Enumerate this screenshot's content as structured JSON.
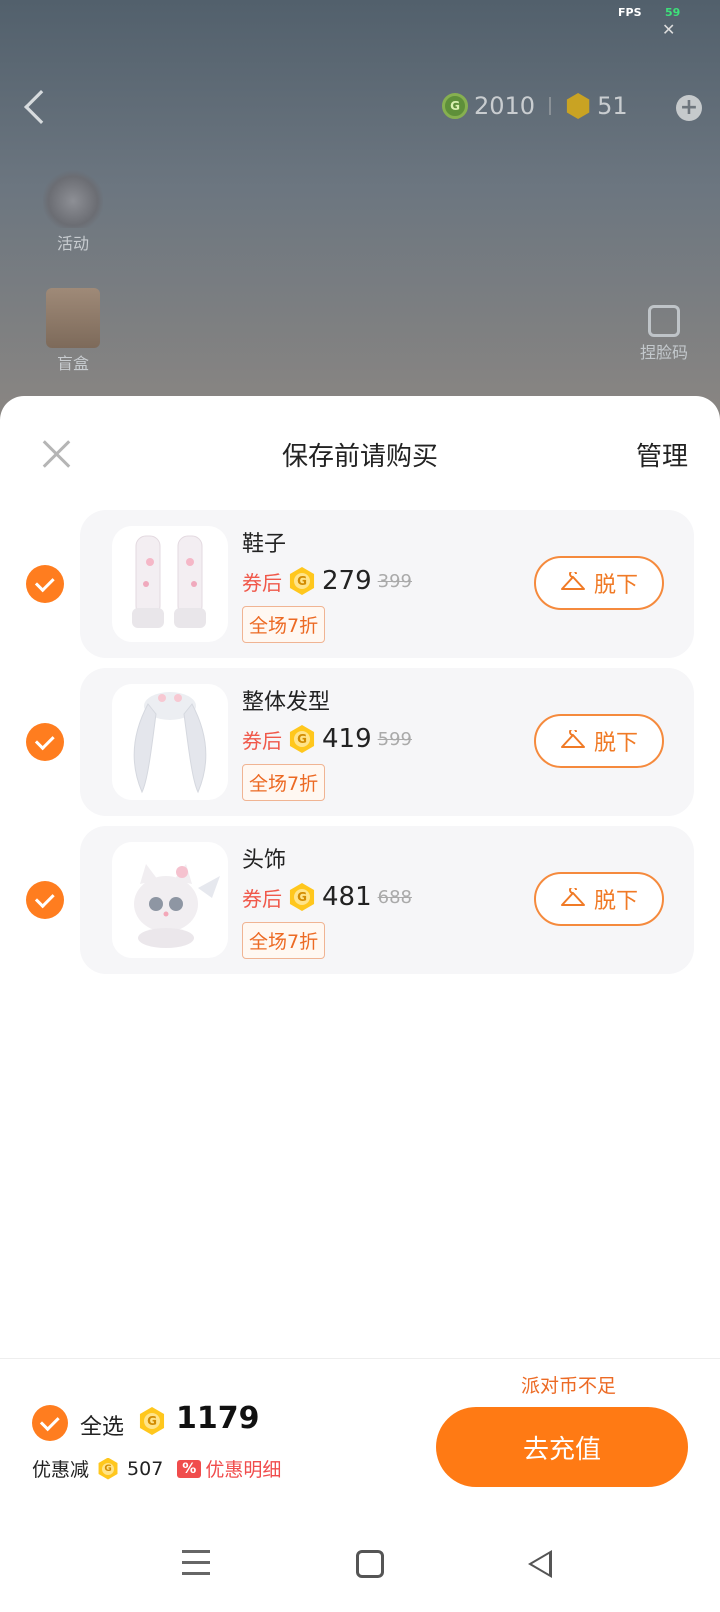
{
  "status_overlay": {
    "fps_label": "FPS",
    "fps_value": "59",
    "close_symbol": "✕"
  },
  "background_app": {
    "currency_green": "2010",
    "currency_gold": "51",
    "side_items": [
      {
        "label": "活动",
        "icon": "star-activity-icon"
      },
      {
        "label": "盲盒",
        "icon": "gift-box-icon"
      }
    ],
    "face_button_label": "捏脸码"
  },
  "sheet": {
    "title": "保存前请购买",
    "manage_label": "管理",
    "items": [
      {
        "name": "鞋子",
        "coupon_label": "券后",
        "price": "279",
        "original_price": "399",
        "discount_tag": "全场7折",
        "action_label": "脱下",
        "checked": true
      },
      {
        "name": "整体发型",
        "coupon_label": "券后",
        "price": "419",
        "original_price": "599",
        "discount_tag": "全场7折",
        "action_label": "脱下",
        "checked": true
      },
      {
        "name": "头饰",
        "coupon_label": "券后",
        "price": "481",
        "original_price": "688",
        "discount_tag": "全场7折",
        "action_label": "脱下",
        "checked": true
      }
    ]
  },
  "footer": {
    "select_all_label": "全选",
    "total": "1179",
    "discount_label": "优惠减",
    "discount_value": "507",
    "discount_icon": "%",
    "discount_detail_label": "优惠明细",
    "insufficient_label": "派对币不足",
    "recharge_label": "去充值"
  },
  "colors": {
    "accent": "#ff7a14",
    "price_red": "#f0584a",
    "coin_gold": "#ffc71d"
  }
}
